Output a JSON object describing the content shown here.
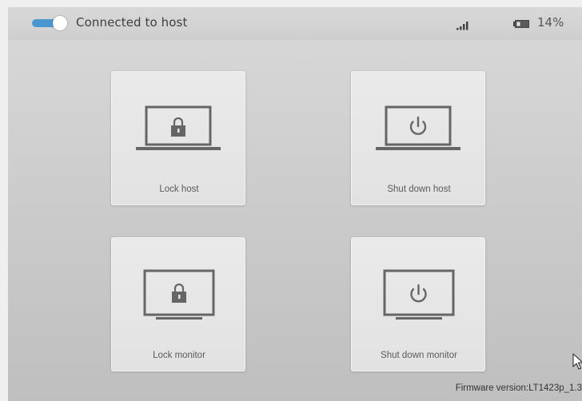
{
  "status_bar": {
    "toggle_on": true,
    "connection_label": "Connected to host",
    "signal_icon": "signal-bars-icon",
    "battery_icon": "battery-icon",
    "battery_level": "14%"
  },
  "actions": [
    {
      "label": "Lock host",
      "icon": "laptop-lock-icon"
    },
    {
      "label": "Shut down host",
      "icon": "laptop-power-icon"
    },
    {
      "label": "Lock monitor",
      "icon": "monitor-lock-icon"
    },
    {
      "label": "Shut down monitor",
      "icon": "monitor-power-icon"
    }
  ],
  "footer": {
    "firmware": "Firmware version:LT1423p_1.3"
  },
  "colors": {
    "toggle_accent": "#4a96cf",
    "icon_gray": "#666666",
    "card_bg": "#e6e6e6"
  }
}
